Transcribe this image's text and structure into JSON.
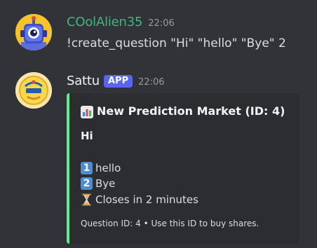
{
  "messages": [
    {
      "username": "COolAlien35",
      "timestamp": "22:06",
      "content": "!create_question \"Hi\" \"hello\" \"Bye\" 2",
      "username_color": "#43b581",
      "avatar_icon": "alien-robot-avatar"
    },
    {
      "username": "Sattu",
      "badge": "APP",
      "timestamp": "22:06",
      "avatar_icon": "super-kings-logo-avatar",
      "embed": {
        "accent_color": "#57f287",
        "title_icon": "bar-chart-icon",
        "title": "New Prediction Market (ID: 4)",
        "question": "Hi",
        "options": [
          {
            "number": "1",
            "label": "hello"
          },
          {
            "number": "2",
            "label": "Bye"
          }
        ],
        "close_icon": "hourglass-icon",
        "close_text": "Closes in 2 minutes",
        "footer": "Question ID: 4 • Use this ID to buy shares."
      }
    }
  ]
}
